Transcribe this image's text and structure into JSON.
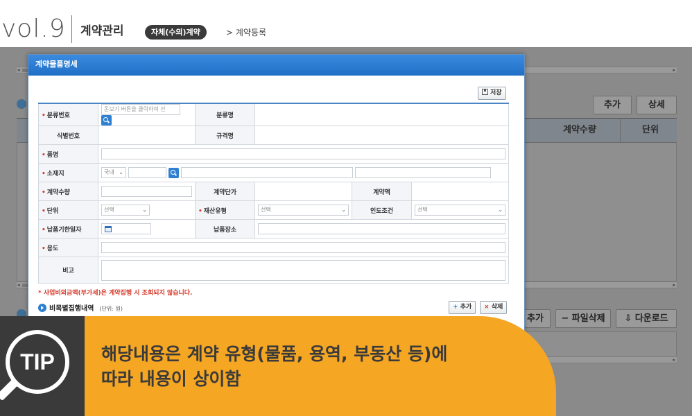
{
  "header": {
    "vol": "vol.9",
    "title": "계약관리",
    "badge": "자체(수의)계약",
    "breadcrumb": "> 계약등록"
  },
  "background": {
    "buttons_top": [
      "추가",
      "상세"
    ],
    "columns": [
      "계약수량",
      "단위"
    ],
    "buttons_bottom": [
      "추가",
      "파일삭제",
      "다운로드"
    ]
  },
  "modal": {
    "title": "계약물품명세",
    "save_label": "저장",
    "fields": {
      "category_no": {
        "label": "분류번호",
        "placeholder": "돋보기 버튼을 클릭하여 선"
      },
      "category_name": {
        "label": "분류명"
      },
      "id_no": {
        "label": "식별번호"
      },
      "spec_name": {
        "label": "규격명"
      },
      "item_name": {
        "label": "품명"
      },
      "location": {
        "label": "소재지",
        "select": "국내"
      },
      "contract_qty": {
        "label": "계약수량"
      },
      "unit_price": {
        "label": "계약단가"
      },
      "amount": {
        "label": "계약액"
      },
      "unit": {
        "label": "단위",
        "select": "선택"
      },
      "asset_type": {
        "label": "재산유형",
        "select": "선택"
      },
      "delivery_terms": {
        "label": "인도조건",
        "select": "선택"
      },
      "due_date": {
        "label": "납품기한일자"
      },
      "delivery_place": {
        "label": "납품장소"
      },
      "purpose": {
        "label": "용도"
      },
      "remarks": {
        "label": "비고"
      }
    },
    "note": "* 사업비외금액(부가세)은 계약집행 시 조회되지 않습니다.",
    "section_title": "비목별집행내역",
    "section_unit": "(단위: 원)",
    "add_label": "추가",
    "delete_label": "삭제"
  },
  "tip": {
    "badge": "TIP",
    "line1": "해당내용은 계약 유형(물품, 용역, 부동산 등)에",
    "line2": "따라 내용이 상이함"
  },
  "colors": {
    "tip_yellow": "#f5a623",
    "tip_dark": "#3a3a3a",
    "modal_header": "#1f6fc6",
    "required": "#d63a2a"
  }
}
